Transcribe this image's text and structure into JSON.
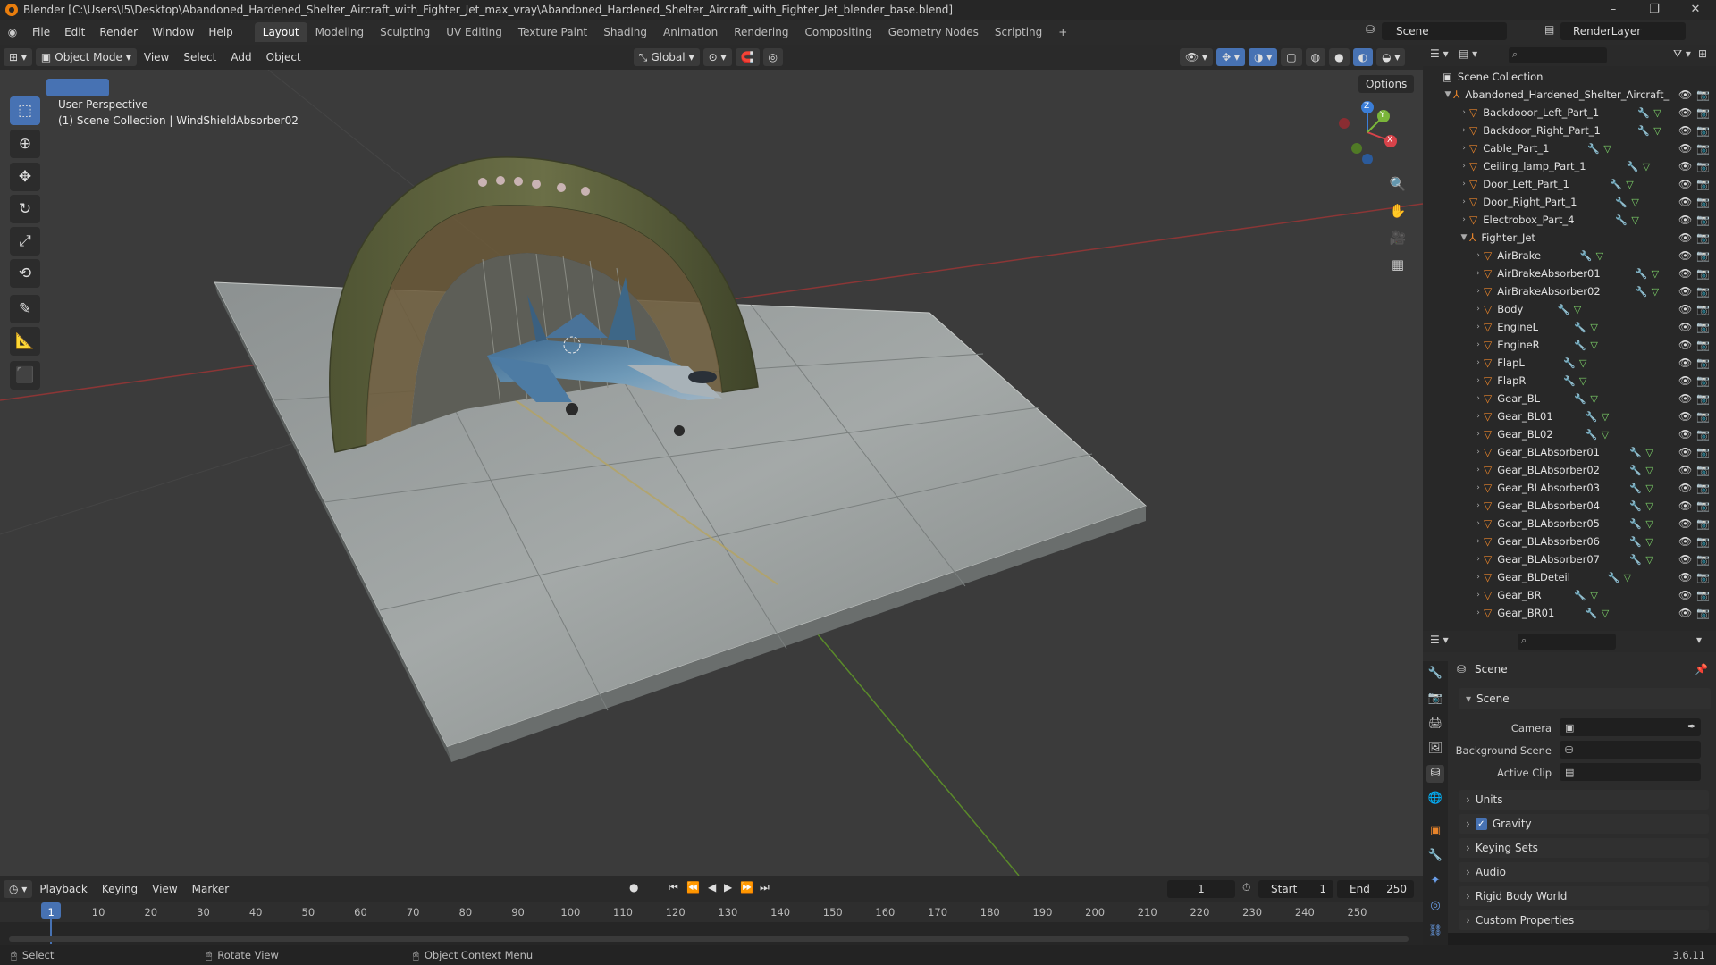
{
  "window": {
    "title": "Blender [C:\\Users\\I5\\Desktop\\Abandoned_Hardened_Shelter_Aircraft_with_Fighter_Jet_max_vray\\Abandoned_Hardened_Shelter_Aircraft_with_Fighter_Jet_blender_base.blend]",
    "minimize": "–",
    "restore": "❐",
    "close": "✕"
  },
  "menu": {
    "items": [
      "File",
      "Edit",
      "Render",
      "Window",
      "Help"
    ],
    "workspaces": [
      "Layout",
      "Modeling",
      "Sculpting",
      "UV Editing",
      "Texture Paint",
      "Shading",
      "Animation",
      "Rendering",
      "Compositing",
      "Geometry Nodes",
      "Scripting"
    ],
    "add_tab": "+",
    "scene_label": "Scene",
    "render_layer_label": "RenderLayer"
  },
  "viewport_header": {
    "mode": "Object Mode",
    "menus": [
      "View",
      "Select",
      "Add",
      "Object"
    ],
    "orientation": "Global",
    "options": "Options"
  },
  "viewport": {
    "perspective": "User Perspective",
    "collection_info": "(1) Scene Collection | WindShieldAbsorber02",
    "gizmo": {
      "z": "Z",
      "y": "Y",
      "x": "X"
    }
  },
  "outliner": {
    "root": "Scene Collection",
    "collection": "Abandoned_Hardened_Shelter_Aircraft_",
    "items": [
      {
        "name": "Backdooor_Left_Part_1",
        "level": 1
      },
      {
        "name": "Backdoor_Right_Part_1",
        "level": 1
      },
      {
        "name": "Cable_Part_1",
        "level": 1
      },
      {
        "name": "Ceiling_lamp_Part_1",
        "level": 1
      },
      {
        "name": "Door_Left_Part_1",
        "level": 1
      },
      {
        "name": "Door_Right_Part_1",
        "level": 1
      },
      {
        "name": "Electrobox_Part_4",
        "level": 1
      },
      {
        "name": "Fighter_Jet",
        "level": 1,
        "expanded": true
      },
      {
        "name": "AirBrake",
        "level": 2
      },
      {
        "name": "AirBrakeAbsorber01",
        "level": 2
      },
      {
        "name": "AirBrakeAbsorber02",
        "level": 2
      },
      {
        "name": "Body",
        "level": 2
      },
      {
        "name": "EngineL",
        "level": 2
      },
      {
        "name": "EngineR",
        "level": 2
      },
      {
        "name": "FlapL",
        "level": 2
      },
      {
        "name": "FlapR",
        "level": 2
      },
      {
        "name": "Gear_BL",
        "level": 2
      },
      {
        "name": "Gear_BL01",
        "level": 2
      },
      {
        "name": "Gear_BL02",
        "level": 2
      },
      {
        "name": "Gear_BLAbsorber01",
        "level": 2
      },
      {
        "name": "Gear_BLAbsorber02",
        "level": 2
      },
      {
        "name": "Gear_BLAbsorber03",
        "level": 2
      },
      {
        "name": "Gear_BLAbsorber04",
        "level": 2
      },
      {
        "name": "Gear_BLAbsorber05",
        "level": 2
      },
      {
        "name": "Gear_BLAbsorber06",
        "level": 2
      },
      {
        "name": "Gear_BLAbsorber07",
        "level": 2
      },
      {
        "name": "Gear_BLDeteil",
        "level": 2
      },
      {
        "name": "Gear_BR",
        "level": 2
      },
      {
        "name": "Gear_BR01",
        "level": 2
      }
    ]
  },
  "properties": {
    "breadcrumb": "Scene",
    "section": "Scene",
    "camera_label": "Camera",
    "background_scene_label": "Background Scene",
    "active_clip_label": "Active Clip",
    "panels": [
      "Units",
      "Gravity",
      "Keying Sets",
      "Audio",
      "Rigid Body World",
      "Custom Properties"
    ],
    "gravity_checked": true
  },
  "timeline": {
    "menus": [
      "Playback",
      "Keying",
      "View",
      "Marker"
    ],
    "current_frame": "1",
    "start_label": "Start",
    "start": "1",
    "end_label": "End",
    "end": "250",
    "ticks": [
      "1",
      "10",
      "20",
      "30",
      "40",
      "50",
      "60",
      "70",
      "80",
      "90",
      "100",
      "110",
      "120",
      "130",
      "140",
      "150",
      "160",
      "170",
      "180",
      "190",
      "200",
      "210",
      "220",
      "230",
      "240",
      "250"
    ]
  },
  "status": {
    "select": "Select",
    "rotate": "Rotate View",
    "context": "Object Context Menu",
    "version": "3.6.11"
  }
}
